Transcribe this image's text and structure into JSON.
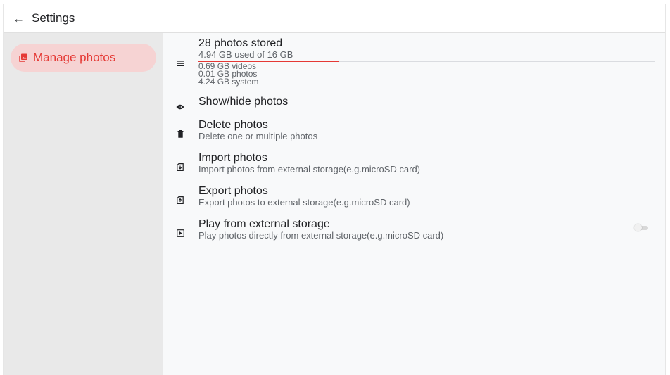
{
  "header": {
    "title": "Settings",
    "back_icon": "arrow-left-icon"
  },
  "colors": {
    "accent": "#e53935",
    "nav_active_bg": "#f6d3d3",
    "sidebar_bg": "#e9e9e9"
  },
  "sidebar": {
    "items": [
      {
        "label": "Manage photos",
        "icon": "photo-library-icon",
        "active": true
      }
    ]
  },
  "storage": {
    "icon": "list-icon",
    "title": "28 photos stored",
    "used": "4.94 GB used of 16 GB",
    "used_fraction": 0.309,
    "details": [
      "0.69 GB videos",
      "0.01 GB photos",
      "4.24 GB system"
    ]
  },
  "items": [
    {
      "icon": "eye-icon",
      "title": "Show/hide photos",
      "subtitle": ""
    },
    {
      "icon": "trash-icon",
      "title": "Delete photos",
      "subtitle": "Delete one or multiple photos"
    },
    {
      "icon": "sd-card-import-icon",
      "title": "Import photos",
      "subtitle": "Import photos from external storage(e.g.microSD card)"
    },
    {
      "icon": "sd-card-export-icon",
      "title": "Export photos",
      "subtitle": "Export photos to external storage(e.g.microSD card)"
    },
    {
      "icon": "play-box-icon",
      "title": "Play from external storage",
      "subtitle": "Play photos directly from external storage(e.g.microSD card)",
      "toggle_on": false
    }
  ]
}
